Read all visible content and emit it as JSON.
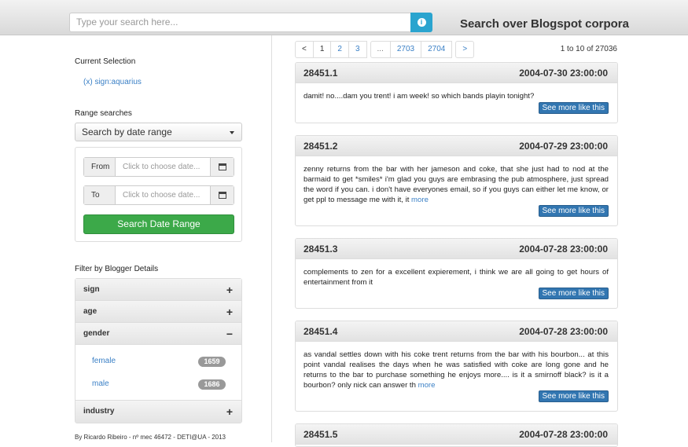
{
  "search": {
    "placeholder": "Type your search here...",
    "info_icon": "info-circle-icon"
  },
  "app_title": "Search over Blogspot corpora",
  "sidebar": {
    "current_selection_heading": "Current Selection",
    "current_selection_item": "(x) sign:aquarius",
    "range_heading": "Range searches",
    "range_select_value": "Search by date range",
    "from_label": "From",
    "from_placeholder": "Click to choose date...",
    "to_label": "To",
    "to_placeholder": "Click to choose date...",
    "range_button": "Search Date Range",
    "filter_heading": "Filter by Blogger Details",
    "filters": [
      {
        "label": "sign",
        "sign": "+"
      },
      {
        "label": "age",
        "sign": "+"
      },
      {
        "label": "gender",
        "sign": "−",
        "items": [
          {
            "label": "female",
            "count": "1659"
          },
          {
            "label": "male",
            "count": "1686"
          }
        ]
      },
      {
        "label": "industry",
        "sign": "+"
      }
    ],
    "footer": "By Ricardo Ribeiro - nº mec 46472 - DETI@UA - 2013"
  },
  "pagination": {
    "pages": [
      "<",
      "1",
      "2",
      "3",
      "...",
      "2703",
      "2704",
      ">"
    ]
  },
  "result_count": "1 to 10 of 27036",
  "results": [
    {
      "id": "28451.1",
      "date": "2004-07-30 23:00:00",
      "text": "damit! no....dam you trent! i am week! so which bands playin tonight?",
      "more": "",
      "button": "See more like this"
    },
    {
      "id": "28451.2",
      "date": "2004-07-29 23:00:00",
      "text": "zenny returns from the bar with her jameson and coke, that she just had to nod at the barmaid to get *smiles* i'm glad you guys are embrasing the pub atmosphere, just spread the word if you can. i don't have everyones email, so if you guys can either let me know, or get ppl to message me with it, it",
      "more": "more",
      "button": "See more like this"
    },
    {
      "id": "28451.3",
      "date": "2004-07-28 23:00:00",
      "text": "complements to zen for a excellent expierement, i think we are all going to get hours of entertainment from it",
      "more": "",
      "button": "See more like this"
    },
    {
      "id": "28451.4",
      "date": "2004-07-28 23:00:00",
      "text": "as vandal settles down with his coke trent returns from the bar with his bourbon... at this point vandal realises the days when he was satisfied with coke are long gone and he returns to the bar to purchase something he enjoys more.... is it a smirnoff black? is it a bourbon? only nick can answer th",
      "more": "more",
      "button": "See more like this"
    },
    {
      "id": "28451.5",
      "date": "2004-07-28 23:00:00"
    }
  ]
}
